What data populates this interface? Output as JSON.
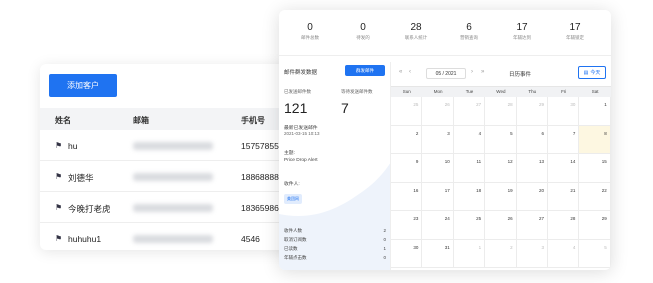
{
  "customer_panel": {
    "add_button": "添加客户",
    "headers": [
      "姓名",
      "邮箱",
      "手机号"
    ],
    "rows": [
      {
        "name": "hu",
        "phone": "15757855"
      },
      {
        "name": "刘德华",
        "phone": "18868888"
      },
      {
        "name": "今晚打老虎",
        "phone": "18365986"
      },
      {
        "name": "huhuhu1",
        "phone": "4546"
      }
    ]
  },
  "stats": [
    {
      "value": "0",
      "label": "邮件总数"
    },
    {
      "value": "0",
      "label": "待发的"
    },
    {
      "value": "28",
      "label": "联系人统计"
    },
    {
      "value": "6",
      "label": "营销查询"
    },
    {
      "value": "17",
      "label": "年辅达到"
    },
    {
      "value": "17",
      "label": "年辅锁定"
    }
  ],
  "mail": {
    "title": "邮件群发数据",
    "send_button": "群发邮件",
    "sent_label": "已发送邮件数",
    "sent_value": "121",
    "waiting_label": "等待发送邮件数",
    "waiting_value": "7",
    "latest_label": "最新已发送邮件",
    "latest_time": "2021-03-15 10:13",
    "subject_label": "主题:",
    "subject": "Price Drop Alert",
    "recipient_label": "收件人:",
    "recipient_tag": "美团网",
    "counters": [
      {
        "label": "收件人数",
        "value": "2"
      },
      {
        "label": "取消订阅数",
        "value": "0"
      },
      {
        "label": "已读数",
        "value": "1"
      },
      {
        "label": "年辅点击数",
        "value": "0"
      }
    ]
  },
  "calendar": {
    "month": "05 / 2021",
    "title": "日历事件",
    "today": "今天",
    "days": [
      "Sun",
      "Mon",
      "Tue",
      "Wed",
      "Thu",
      "Fri",
      "Sat"
    ],
    "weeks": [
      [
        "25",
        "26",
        "27",
        "28",
        "29",
        "30",
        "1"
      ],
      [
        "2",
        "3",
        "4",
        "5",
        "6",
        "7",
        "8"
      ],
      [
        "9",
        "10",
        "11",
        "12",
        "13",
        "14",
        "15"
      ],
      [
        "16",
        "17",
        "18",
        "19",
        "20",
        "21",
        "22"
      ],
      [
        "23",
        "24",
        "25",
        "26",
        "27",
        "28",
        "29"
      ],
      [
        "30",
        "31",
        "1",
        "2",
        "3",
        "4",
        "5"
      ]
    ],
    "accent": "#1f73f1",
    "highlight": "#fdf7e1"
  }
}
